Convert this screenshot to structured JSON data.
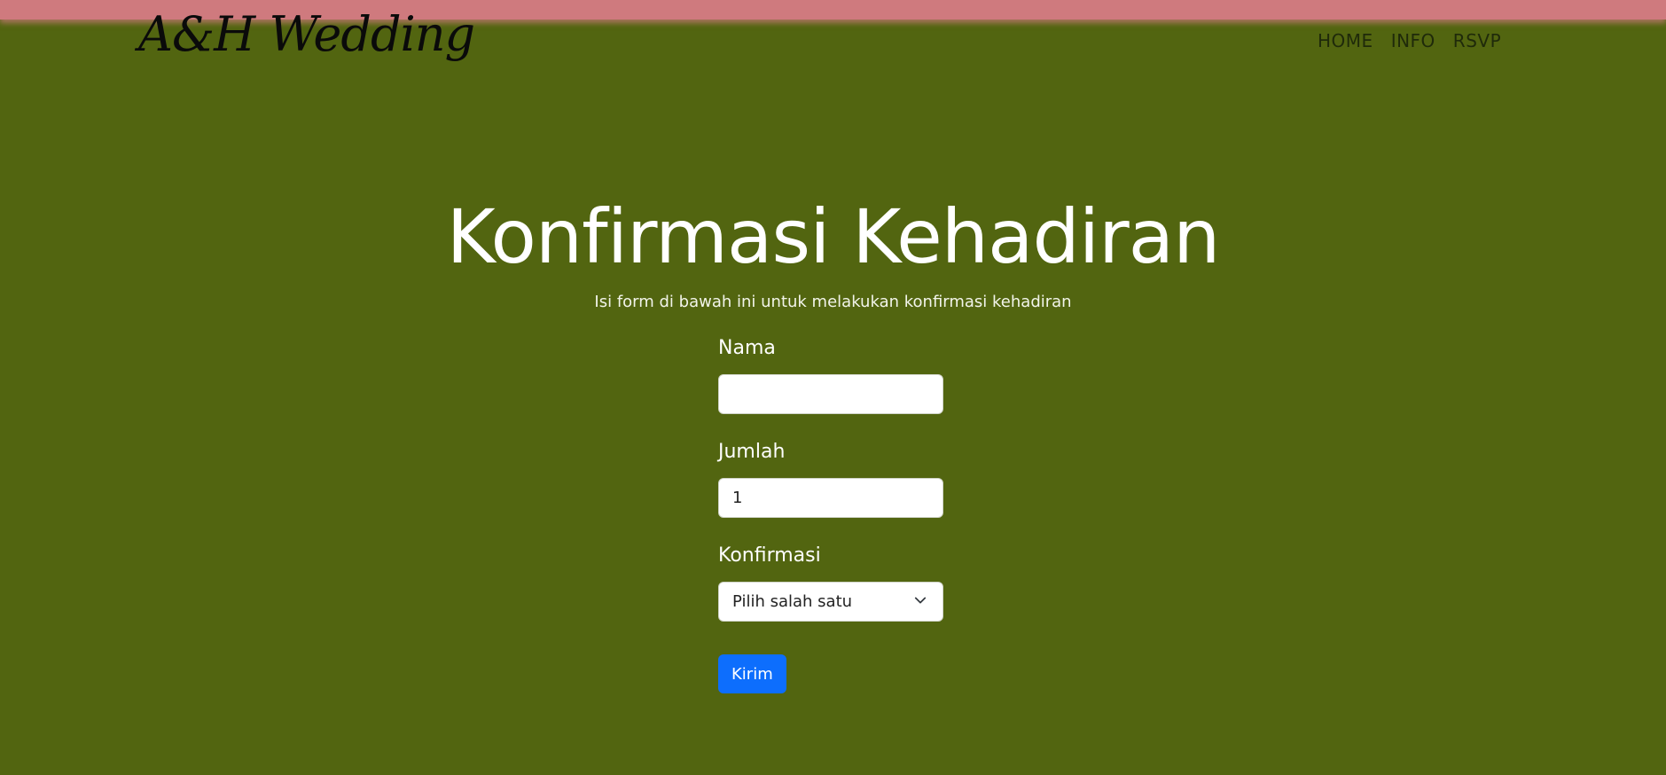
{
  "header": {
    "brand": "A&H Wedding",
    "nav": [
      "HOME",
      "INFO",
      "RSVP"
    ],
    "accent_color": "#cf7a7e"
  },
  "main": {
    "title": "Konfirmasi Kehadiran",
    "subtitle": "Isi form di bawah ini untuk melakukan konfirmasi kehadiran",
    "background_color": "#526510"
  },
  "form": {
    "name_label": "Nama",
    "name_value": "",
    "count_label": "Jumlah",
    "count_value": "1",
    "confirm_label": "Konfirmasi",
    "confirm_selected": "Pilih salah satu",
    "submit_label": "Kirim",
    "submit_color": "#0d6efd",
    "chevron_icon": "chevron-down-icon"
  }
}
